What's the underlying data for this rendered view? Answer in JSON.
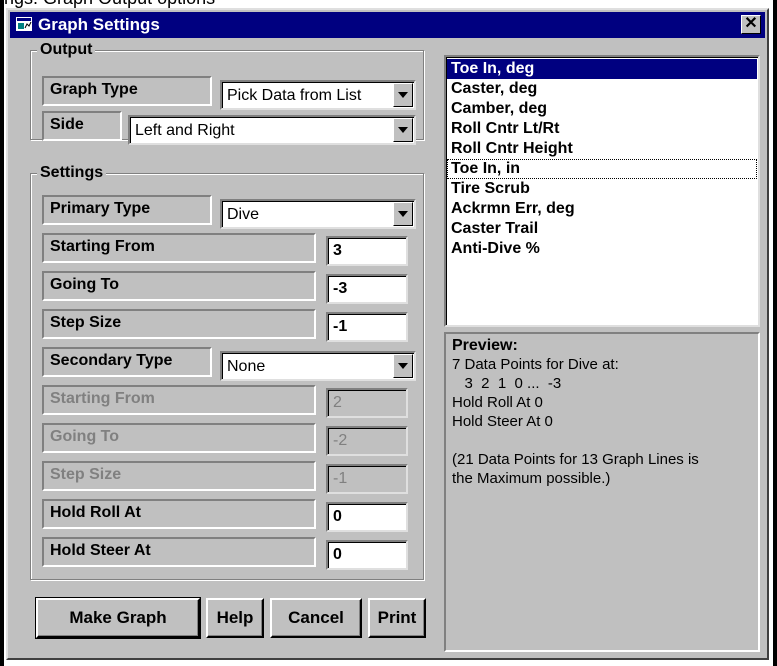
{
  "background_text": "ngs.  Graph Output options",
  "window": {
    "title": "Graph Settings",
    "close_glyph": "✕"
  },
  "output": {
    "group_title": "Output",
    "graph_type_label": "Graph Type",
    "graph_type_value": "Pick Data from List",
    "side_label": "Side",
    "side_value": "Left and Right"
  },
  "settings": {
    "group_title": "Settings",
    "primary_type_label": "Primary Type",
    "primary_type_value": "Dive",
    "primary_starting_label": "Starting From",
    "primary_starting_value": "3",
    "primary_going_label": "Going To",
    "primary_going_value": "-3",
    "primary_step_label": "Step Size",
    "primary_step_value": "-1",
    "secondary_type_label": "Secondary Type",
    "secondary_type_value": "None",
    "secondary_starting_label": "Starting From",
    "secondary_starting_value": "2",
    "secondary_going_label": "Going To",
    "secondary_going_value": "-2",
    "secondary_step_label": "Step Size",
    "secondary_step_value": "-1",
    "hold_roll_label": "Hold Roll At",
    "hold_roll_value": "0",
    "hold_steer_label": "Hold Steer At",
    "hold_steer_value": "0"
  },
  "data_list": {
    "items": [
      "Toe In, deg",
      "Caster, deg",
      "Camber, deg",
      "Roll Cntr Lt/Rt",
      "Roll Cntr Height",
      "Toe In, in",
      "Tire Scrub",
      "Ackrmn Err, deg",
      "Caster Trail",
      "Anti-Dive %"
    ],
    "selected_index": 0,
    "focused_index": 5
  },
  "preview": {
    "heading": "Preview:",
    "line1": "7 Data Points for Dive at:",
    "line2": "   3  2  1  0 ...  -3",
    "line3": "Hold Roll At 0",
    "line4": "Hold Steer At 0",
    "line5": "(21 Data Points for 13 Graph Lines is",
    "line6": "the Maximum possible.)"
  },
  "buttons": {
    "make_graph": "Make Graph",
    "help": "Help",
    "cancel": "Cancel",
    "print": "Print"
  },
  "colors": {
    "titlebar": "#000080",
    "dialog_face": "#c0c0c0",
    "selection": "#000080",
    "disabled_text": "#808080"
  }
}
